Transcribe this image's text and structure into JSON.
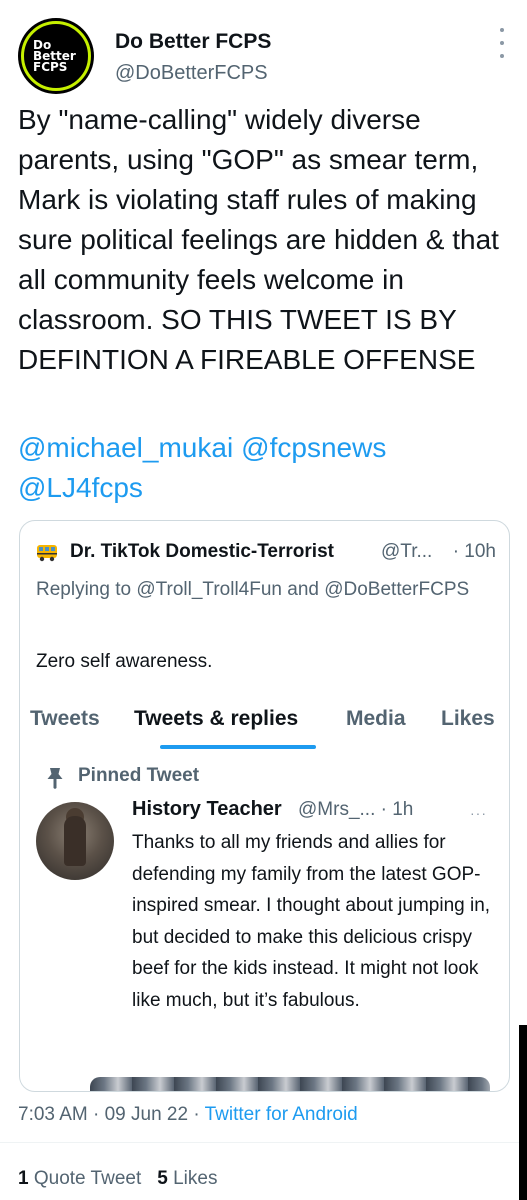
{
  "author": {
    "avatar_text_lines": [
      "Do",
      "Better",
      "FCPS"
    ],
    "name": "Do Better FCPS",
    "handle": "@DoBetterFCPS"
  },
  "tweet": {
    "text": "By \"name-calling\" widely diverse parents, using \"GOP\" as smear term, Mark is violating staff rules of making sure political feelings are hidden & that all community feels welcome in classroom. SO THIS TWEET IS BY DEFINTION A FIREABLE OFFENSE",
    "mentions": [
      "@michael_mukai",
      "@fcpsnews",
      "@LJ4fcps"
    ]
  },
  "quote": {
    "author_name": "Dr. TikTok Domestic-Terrorist",
    "author_handle": "@Tr...",
    "time": "· 10h",
    "replying_to": "Replying to @Troll_Troll4Fun and @DoBetterFCPS",
    "body": "Zero self awareness.",
    "tabs": [
      {
        "label": "Tweets"
      },
      {
        "label": "Tweets & replies"
      },
      {
        "label": "Media"
      },
      {
        "label": "Likes"
      }
    ],
    "pinned_label": "Pinned Tweet",
    "pinned": {
      "name": "History Teacher",
      "handle": "@Mrs_... · 1h",
      "more": "···",
      "text": "Thanks to all my friends and allies for defending my family from the latest GOP-inspired smear.  I thought about jumping in, but decided to make this delicious crispy beef for the kids instead.  It might not look like much, but it’s fabulous."
    }
  },
  "meta": {
    "time": "7:03 AM",
    "date": "09 Jun 22",
    "source": "Twitter for Android"
  },
  "stats": {
    "quote_count": "1",
    "quote_label": "Quote Tweet",
    "like_count": "5",
    "like_label": "Likes"
  },
  "colors": {
    "accent": "#1d9bf0",
    "text_primary": "#0f1419",
    "text_secondary": "#536471",
    "avatar_ring": "#c6f000"
  },
  "icons": {
    "more": "more-vertical-icon",
    "pin": "pin-icon",
    "quote_author_emoji": "school-bus-emoji-icon"
  }
}
